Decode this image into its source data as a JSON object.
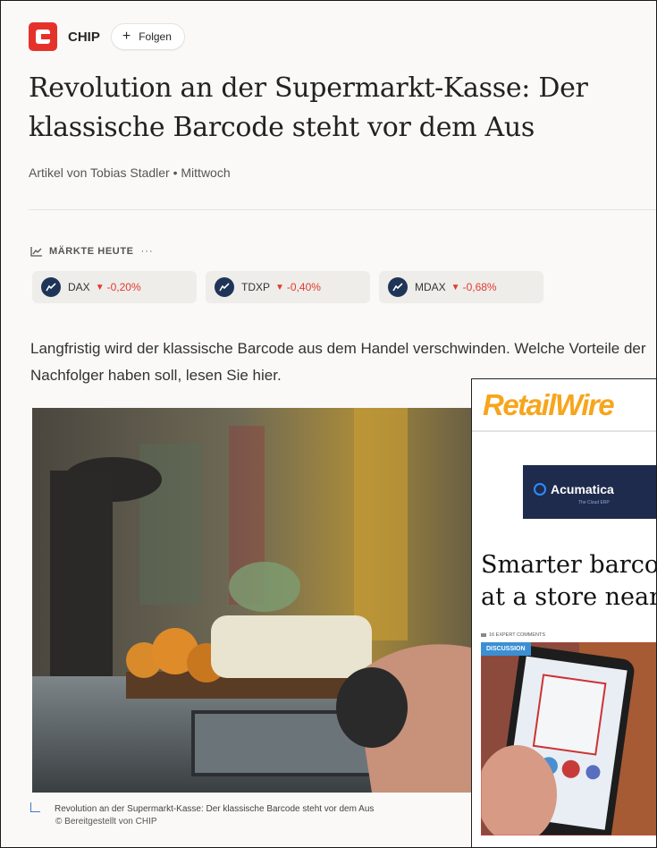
{
  "publisher": {
    "name": "CHIP",
    "follow_label": "Folgen"
  },
  "article": {
    "title": "Revolution an der Supermarkt-Kasse: Der klassische Barcode steht vor dem Aus",
    "byline": "Artikel von Tobias Stadler • Mittwoch",
    "intro": "Langfristig wird der klassische Barcode aus dem Handel verschwinden. Welche Vorteile der Nachfolger haben soll, lesen Sie hier.",
    "caption": "Revolution an der Supermarkt-Kasse: Der klassische Barcode steht vor dem Aus",
    "credit": "© Bereitgestellt von CHIP"
  },
  "markets": {
    "label": "MÄRKTE HEUTE",
    "more": "···",
    "items": [
      {
        "name": "DAX",
        "change": "-0,20%"
      },
      {
        "name": "TDXP",
        "change": "-0,40%"
      },
      {
        "name": "MDAX",
        "change": "-0,68%"
      }
    ]
  },
  "overlay": {
    "logo": "RetailWire",
    "ad_brand": "Acumatica",
    "ad_tagline": "The Cloud ERP",
    "headline": "Smarter barcodes at a store near you",
    "comments": "16 EXPERT COMMENTS",
    "tag": "DISCUSSION"
  },
  "colors": {
    "brand_red": "#e4322b",
    "negative": "#e03a2f",
    "retailwire_orange": "#f7a51c",
    "market_icon": "#1f3558"
  }
}
